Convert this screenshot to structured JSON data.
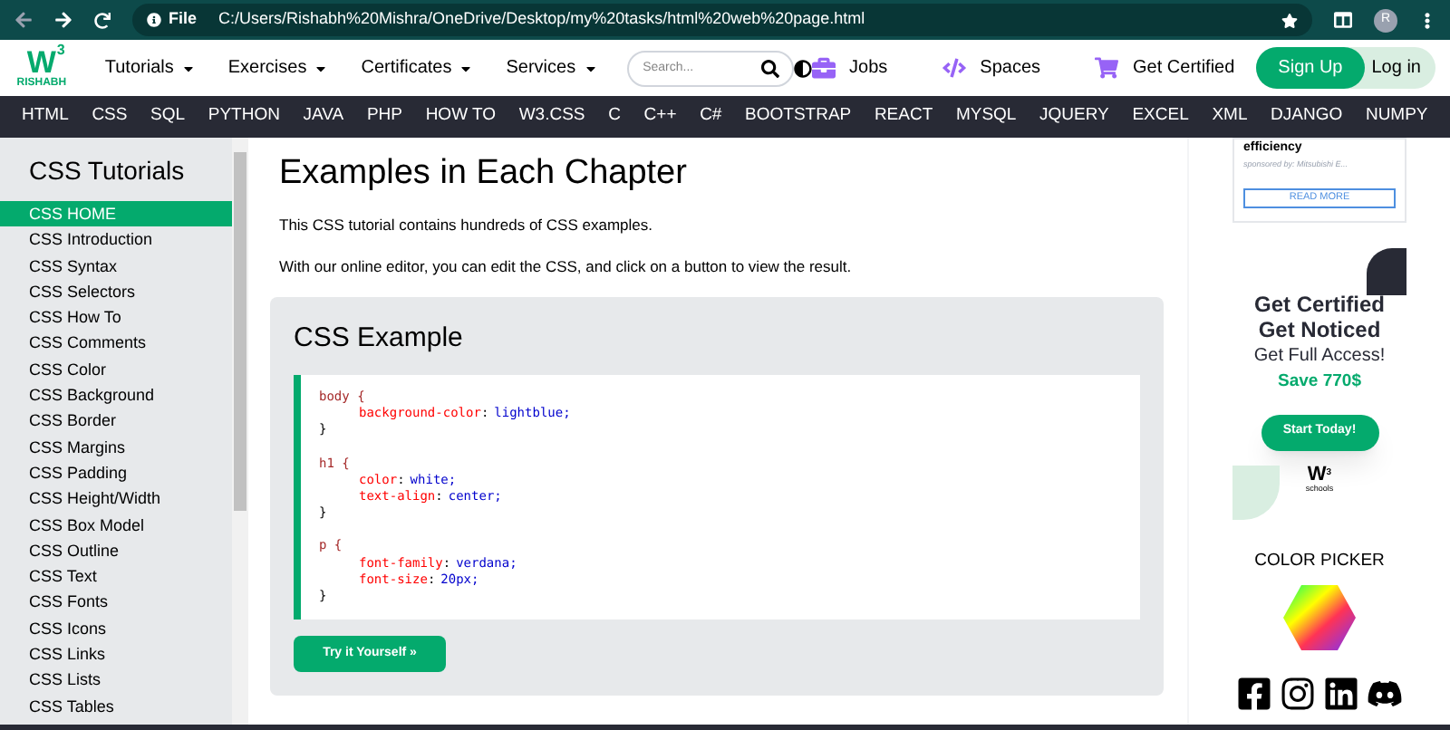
{
  "browser": {
    "site_label": "File",
    "url": "C:/Users/Rishabh%20Mishra/OneDrive/Desktop/my%20tasks/html%20web%20page.html",
    "avatar": "R"
  },
  "header": {
    "logo": {
      "letter": "W",
      "mark": "3",
      "name": "RISHABH"
    },
    "menus": [
      {
        "label": "Tutorials"
      },
      {
        "label": "Exercises"
      },
      {
        "label": "Certificates"
      },
      {
        "label": "Services"
      }
    ],
    "search": {
      "placeholder": "Search..."
    },
    "links": [
      {
        "kind": "jobs",
        "label": "Jobs"
      },
      {
        "kind": "spaces",
        "label": "Spaces"
      },
      {
        "kind": "cart",
        "label": "Get Certified"
      }
    ],
    "signup": "Sign Up",
    "login": "Log in"
  },
  "topnav": [
    "HTML",
    "CSS",
    "SQL",
    "PYTHON",
    "JAVA",
    "PHP",
    "HOW TO",
    "W3.CSS",
    "C",
    "C++",
    "C#",
    "BOOTSTRAP",
    "REACT",
    "MYSQL",
    "JQUERY",
    "EXCEL",
    "XML",
    "DJANGO",
    "NUMPY"
  ],
  "sidebar": {
    "title": "CSS Tutorials",
    "items": [
      {
        "label": "CSS HOME",
        "selected": true
      },
      {
        "label": "CSS Introduction",
        "selected": false
      },
      {
        "label": "CSS Syntax",
        "selected": false
      },
      {
        "label": "CSS Selectors",
        "selected": false
      },
      {
        "label": "CSS How To",
        "selected": false
      },
      {
        "label": "CSS Comments",
        "selected": false
      },
      {
        "label": "CSS Color",
        "selected": false
      },
      {
        "label": "CSS Background",
        "selected": false
      },
      {
        "label": "CSS Border",
        "selected": false
      },
      {
        "label": "CSS Margins",
        "selected": false
      },
      {
        "label": "CSS Padding",
        "selected": false
      },
      {
        "label": "CSS Height/Width",
        "selected": false
      },
      {
        "label": "CSS Box Model",
        "selected": false
      },
      {
        "label": "CSS Outline",
        "selected": false
      },
      {
        "label": "CSS Text",
        "selected": false
      },
      {
        "label": "CSS Fonts",
        "selected": false
      },
      {
        "label": "CSS Icons",
        "selected": false
      },
      {
        "label": "CSS Links",
        "selected": false
      },
      {
        "label": "CSS Lists",
        "selected": false
      },
      {
        "label": "CSS Tables",
        "selected": false
      }
    ]
  },
  "main": {
    "heading": "Examples in Each Chapter",
    "paragraphs": [
      "This CSS tutorial contains hundreds of CSS examples.",
      "With our online editor, you can edit the CSS, and click on a button to view the result."
    ],
    "example": {
      "title": "CSS Example",
      "button": "Try it Yourself »",
      "blocks": [
        {
          "open": "body {",
          "close": "}",
          "declarations": [
            {
              "property": "background-color",
              "colon": ":",
              "value": "lightblue;"
            }
          ]
        },
        {
          "open": "h1 {",
          "close": "}",
          "declarations": [
            {
              "property": "color",
              "colon": ":",
              "value": "white;"
            },
            {
              "property": "text-align",
              "colon": ":",
              "value": "center;"
            }
          ]
        },
        {
          "open": "p {",
          "close": "}",
          "declarations": [
            {
              "property": "font-family",
              "colon": ":",
              "value": "verdana;"
            },
            {
              "property": "font-size",
              "colon": ":",
              "value": "20px;"
            }
          ]
        }
      ]
    }
  },
  "aside": {
    "ad": {
      "title": "efficiency",
      "sponsor": "sponsored by: Mitsubishi E...",
      "button": "READ MORE"
    },
    "promo": {
      "line1": "Get Certified",
      "line2": "Get Noticed",
      "line3": "Get Full Access!",
      "offer": "Save 770$",
      "button": "Start Today!",
      "logo_letter": "W",
      "logo_mark": "3",
      "logo_name": "schools"
    },
    "color_picker": "COLOR PICKER",
    "social": [
      {
        "kind": "facebook"
      },
      {
        "kind": "instagram"
      },
      {
        "kind": "linkedin"
      },
      {
        "kind": "discord"
      }
    ]
  }
}
